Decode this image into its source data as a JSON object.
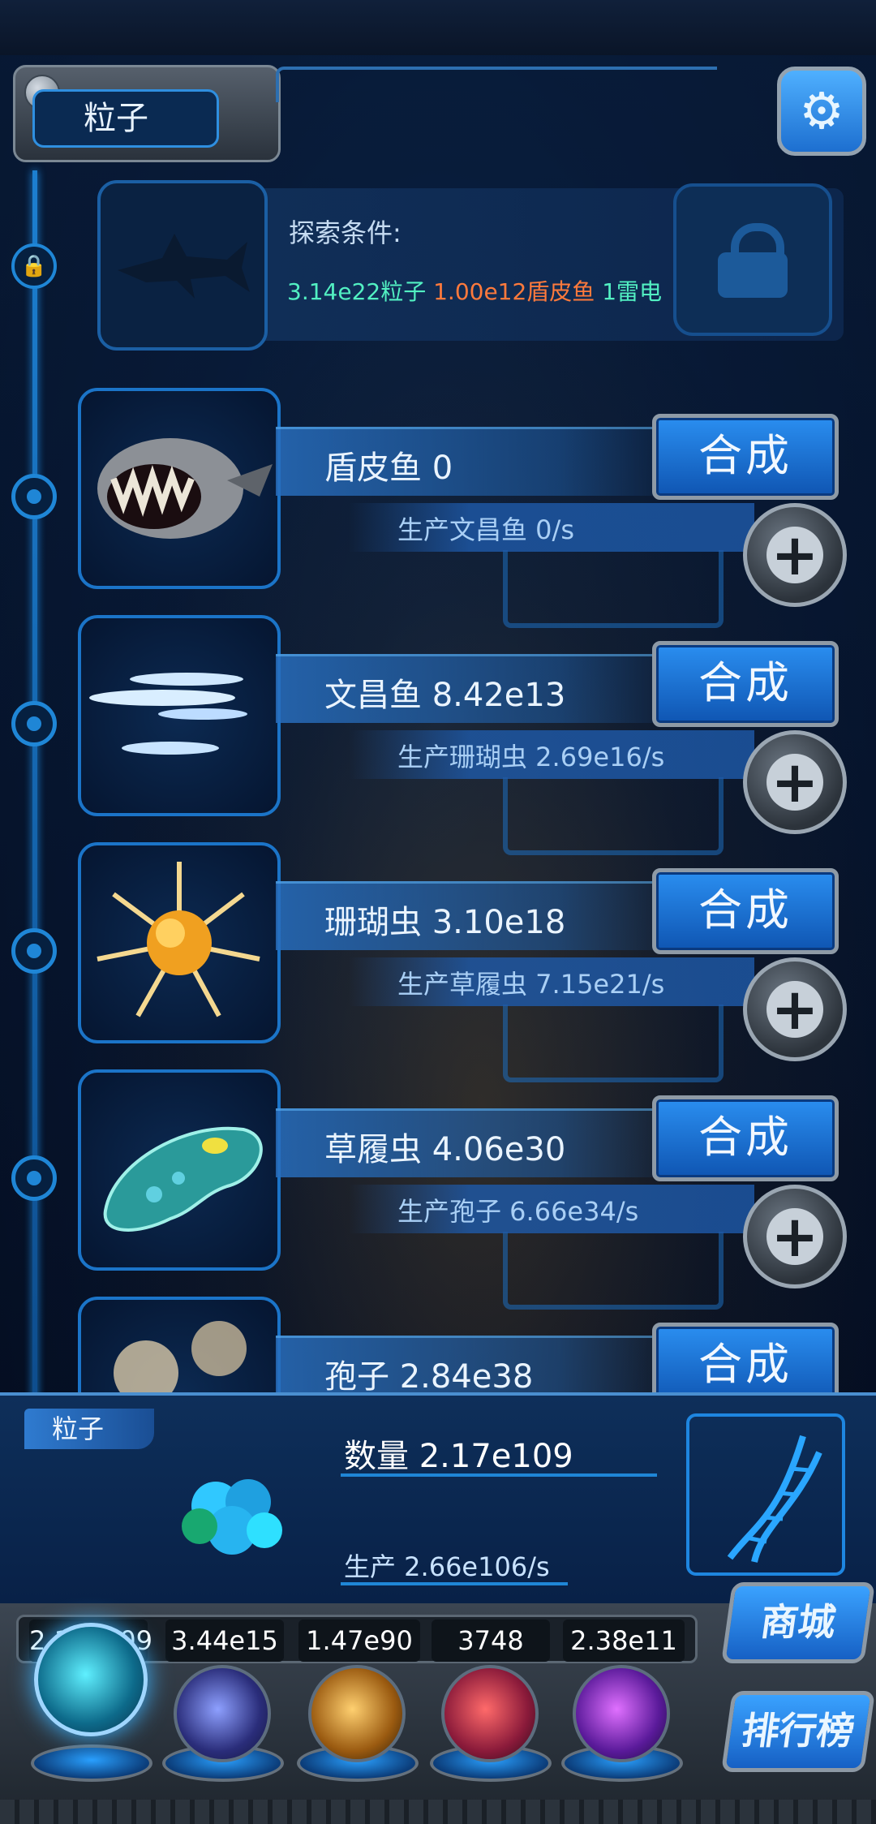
{
  "header": {
    "title": "粒子"
  },
  "locked": {
    "title": "探索条件:",
    "req_particles": "3.14e22粒子",
    "req_shield": "1.00e12盾皮鱼",
    "req_thunder": "1雷电"
  },
  "rows": [
    {
      "name": "盾皮鱼 0",
      "prod": "生产文昌鱼 0/s",
      "synth": "合成"
    },
    {
      "name": "文昌鱼 8.42e13",
      "prod": "生产珊瑚虫 2.69e16/s",
      "synth": "合成"
    },
    {
      "name": "珊瑚虫 3.10e18",
      "prod": "生产草履虫 7.15e21/s",
      "synth": "合成"
    },
    {
      "name": "草履虫 4.06e30",
      "prod": "生产孢子 6.66e34/s",
      "synth": "合成"
    },
    {
      "name": "孢子 2.84e38",
      "synth": "合成"
    }
  ],
  "panel": {
    "tag": "粒子",
    "count": "数量 2.17e109",
    "rate": "生产 2.66e106/s"
  },
  "resources": {
    "values": [
      "2.17e109",
      "3.44e15",
      "1.47e90",
      "3748",
      "2.38e11"
    ]
  },
  "side": {
    "shop": "商城",
    "rank": "排行榜"
  },
  "colors": {
    "req_green": "#52f0c2",
    "req_orange": "#ff7a3c",
    "accent": "#1f86d6"
  }
}
